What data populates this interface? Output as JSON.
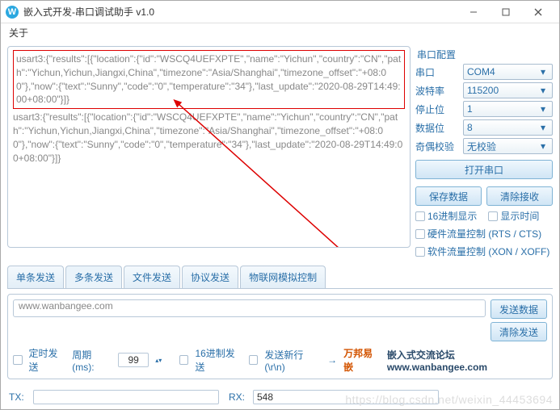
{
  "window": {
    "title": "嵌入式开发-串口调试助手 v1.0"
  },
  "menu": {
    "about": "关于"
  },
  "rx": {
    "hl": "usart3:{\"results\":[{\"location\":{\"id\":\"WSCQ4UEFXPTE\",\"name\":\"Yichun\",\"country\":\"CN\",\"path\":\"Yichun,Yichun,Jiangxi,China\",\"timezone\":\"Asia/Shanghai\",\"timezone_offset\":\"+08:00\"},\"now\":{\"text\":\"Sunny\",\"code\":\"0\",\"temperature\":\"34\"},\"last_update\":\"2020-08-29T14:49:00+08:00\"}]}",
    "plain": "usart3:{\"results\":[{\"location\":{\"id\":\"WSCQ4UEFXPTE\",\"name\":\"Yichun\",\"country\":\"CN\",\"path\":\"Yichun,Yichun,Jiangxi,China\",\"timezone\":\"Asia/Shanghai\",\"timezone_offset\":\"+08:00\"},\"now\":{\"text\":\"Sunny\",\"code\":\"0\",\"temperature\":\"34\"},\"last_update\":\"2020-08-29T14:49:00+08:00\"}]}"
  },
  "cfg": {
    "title": "串口配置",
    "port_lbl": "串口",
    "port_val": "COM4",
    "baud_lbl": "波特率",
    "baud_val": "115200",
    "stop_lbl": "停止位",
    "stop_val": "1",
    "data_lbl": "数据位",
    "data_val": "8",
    "parity_lbl": "奇偶校验",
    "parity_val": "无校验",
    "open_btn": "打开串口",
    "save_btn": "保存数据",
    "clear_btn": "清除接收",
    "chk_hex": "16进制显示",
    "chk_time": "显示时间",
    "chk_rts": "硬件流量控制 (RTS / CTS)",
    "chk_xon": "软件流量控制 (XON / XOFF)"
  },
  "tabs": {
    "t0": "单条发送",
    "t1": "多条发送",
    "t2": "文件发送",
    "t3": "协议发送",
    "t4": "物联网模拟控制"
  },
  "send": {
    "input": "www.wanbangee.com",
    "send_btn": "发送数据",
    "clear_btn": "清除发送",
    "chk_timer": "定时发送",
    "period_lbl": "周期(ms):",
    "period_val": "99",
    "chk_hex": "16进制发送",
    "chk_newline": "发送新行(\\r\\n)",
    "arrow": "→",
    "link1": "万邦易嵌",
    "link2": "嵌入式交流论坛www.wanbangee.com"
  },
  "status": {
    "tx_lbl": "TX:",
    "tx_val": "",
    "rx_lbl": "RX:",
    "rx_val": "548"
  },
  "watermark": "https://blog.csdn.net/weixin_44453694"
}
